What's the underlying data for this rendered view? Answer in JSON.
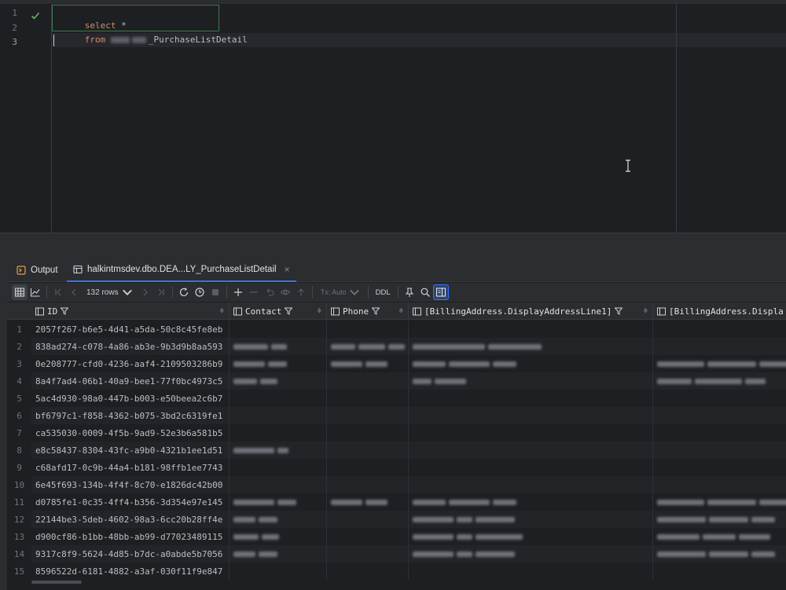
{
  "editor": {
    "line_numbers": [
      "1",
      "2",
      "3"
    ],
    "line1_keyword": "select",
    "line1_rest": " *",
    "line2_keyword": "from",
    "line2_table_suffix": "_PurchaseListDetail"
  },
  "tabs": {
    "output_label": "Output",
    "result_label": "halkintmsdev.dbo.DEA...LY_PurchaseListDetail",
    "close_glyph": "×"
  },
  "toolbar": {
    "rows_label": "132 rows",
    "tx_label": "Tx: Auto",
    "ddl_label": "DDL"
  },
  "grid": {
    "columns": [
      "ID",
      "Contact",
      "Phone",
      "[BillingAddress.DisplayAddressLine1]",
      "[BillingAddress.Displa"
    ],
    "rows": [
      {
        "n": "1",
        "id": "2057f267-b6e5-4d41-a5da-50c8c45fe8eb"
      },
      {
        "n": "2",
        "id": "838ad274-c078-4a86-ab3e-9b3d9b8aa593"
      },
      {
        "n": "3",
        "id": "0e208777-cfd0-4236-aaf4-2109503286b9"
      },
      {
        "n": "4",
        "id": "8a4f7ad4-06b1-40a9-bee1-77f0bc4973c5"
      },
      {
        "n": "5",
        "id": "5ac4d930-98a0-447b-b003-e50beea2c6b7"
      },
      {
        "n": "6",
        "id": "bf6797c1-f858-4362-b075-3bd2c6319fe1"
      },
      {
        "n": "7",
        "id": "ca535030-0009-4f5b-9ad9-52e3b6a581b5"
      },
      {
        "n": "8",
        "id": "e8c58437-8304-43fc-a9b0-4321b1ee1d51"
      },
      {
        "n": "9",
        "id": "c68afd17-0c9b-44a4-b181-98ffb1ee7743"
      },
      {
        "n": "10",
        "id": "6e45f693-134b-4f4f-8c70-e1826dc42b00"
      },
      {
        "n": "11",
        "id": "d0785fe1-0c35-4ff4-b356-3d354e97e145"
      },
      {
        "n": "12",
        "id": "22144be3-5deb-4602-98a3-6cc20b28ff4e"
      },
      {
        "n": "13",
        "id": "d900cf86-b1bb-48bb-ab99-d77023489115"
      },
      {
        "n": "14",
        "id": "9317c8f9-5624-4d85-b7dc-a0abde5b7056"
      },
      {
        "n": "15",
        "id": "8596522d-6181-4882-a3af-030f11f9e847"
      }
    ]
  },
  "colors": {
    "accent": "#3574f0",
    "keyword": "#cf8e6d",
    "success_check": "#5fb865"
  }
}
